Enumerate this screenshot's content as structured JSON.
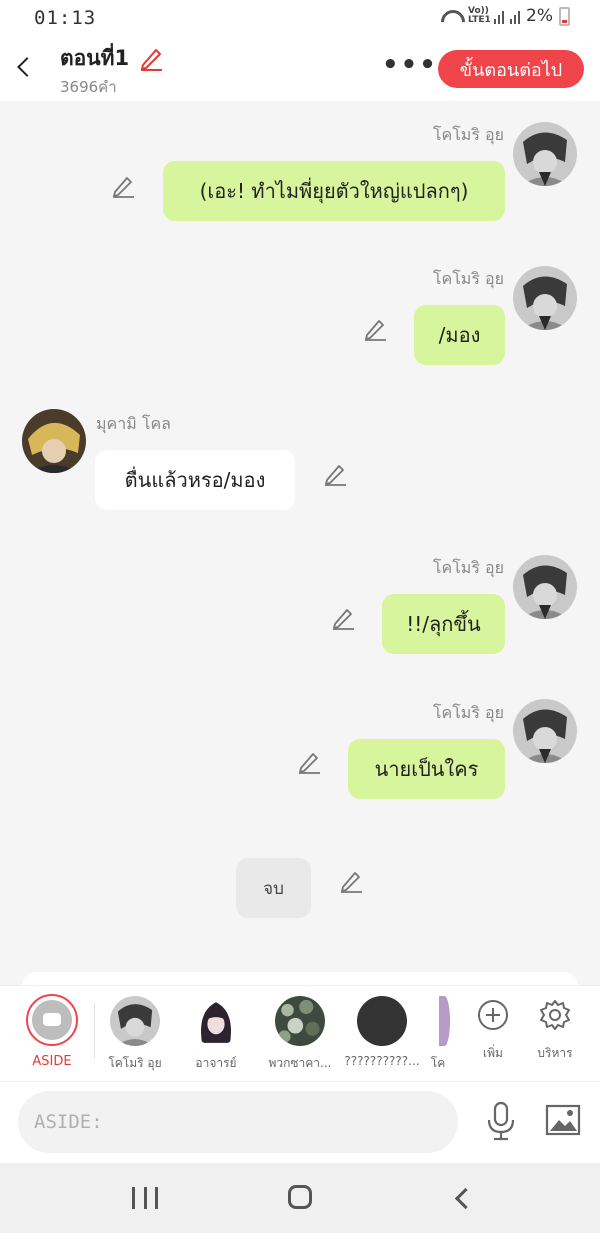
{
  "status_bar": {
    "time": "01:13",
    "network": "LTE1",
    "volte": "Vo))",
    "battery_percent": "2%"
  },
  "header": {
    "episode_title": "ตอนที่1",
    "word_count": "3696คำ",
    "more_icon": "more-dots-icon",
    "next_button": "ขั้นตอนต่อไป"
  },
  "messages": [
    {
      "side": "right",
      "speaker": "โคโมริ อุย",
      "text": "(เอะ! ทำไมพี่ยุยตัวใหญ่แปลกๆ)"
    },
    {
      "side": "right",
      "speaker": "โคโมริ อุย",
      "text": "/มอง"
    },
    {
      "side": "left",
      "speaker": "มุคามิ โคล",
      "text": "ตื่นแล้วหรอ/มอง"
    },
    {
      "side": "right",
      "speaker": "โคโมริ อุย",
      "text": "!!/ลุกขึ้น"
    },
    {
      "side": "right",
      "speaker": "โคโมริ อุย",
      "text": "นายเป็นใคร"
    },
    {
      "side": "center",
      "speaker": "",
      "text": "จบ"
    }
  ],
  "character_bar": {
    "aside_label": "ASIDE",
    "characters": [
      "โคโมริ อุย",
      "อาจารย์",
      "พวกซาคา...",
      "??????????...",
      "โค"
    ],
    "add_label": "เพิ่ม",
    "manage_label": "บริหาร"
  },
  "input": {
    "placeholder": "ASIDE:"
  },
  "colors": {
    "accent": "#f0444b",
    "my_bubble": "#d7f59c",
    "other_bubble": "#ffffff"
  }
}
